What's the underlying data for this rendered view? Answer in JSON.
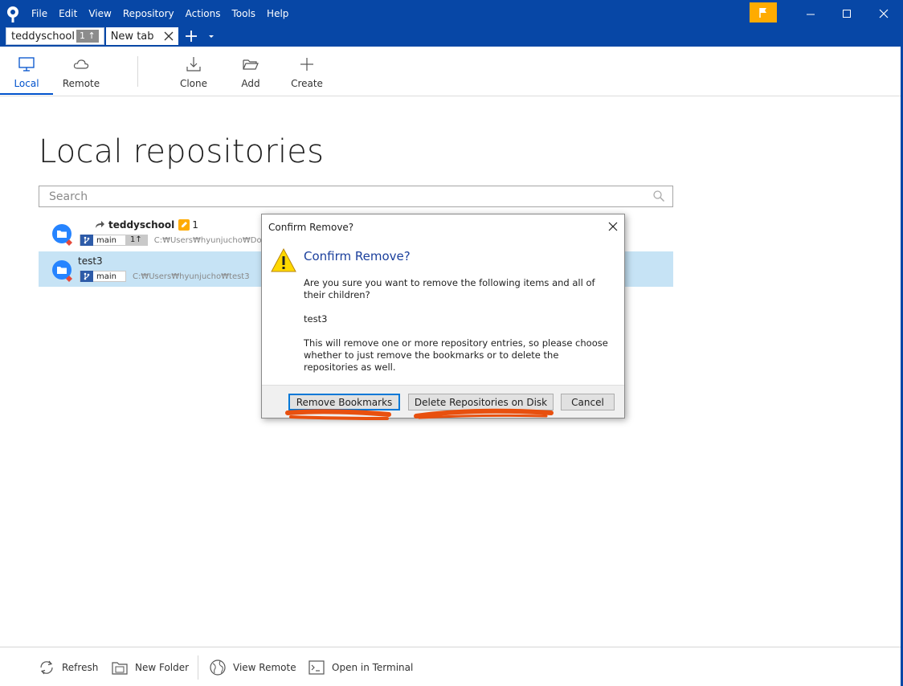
{
  "menu": [
    "File",
    "Edit",
    "View",
    "Repository",
    "Actions",
    "Tools",
    "Help"
  ],
  "tabs": {
    "active": {
      "label": "teddyschool",
      "badge": "1 ↑"
    },
    "new": {
      "label": "New tab"
    }
  },
  "toolbar": {
    "local": "Local",
    "remote": "Remote",
    "clone": "Clone",
    "add": "Add",
    "create": "Create"
  },
  "main": {
    "title": "Local repositories",
    "search_placeholder": "Search"
  },
  "repos": [
    {
      "name": "teddyschool",
      "changes": "1",
      "branch": "main",
      "ahead": "1↑",
      "path": "C:₩Users₩hyunjucho₩Docum"
    },
    {
      "name": "test3",
      "branch": "main",
      "path": "C:₩Users₩hyunjucho₩test3"
    }
  ],
  "dialog": {
    "window_title": "Confirm Remove?",
    "heading": "Confirm Remove?",
    "question": "Are you sure you want to remove the following items and all of their children?",
    "item": "test3",
    "explanation": "This will remove one or more repository entries, so please choose whether to just remove the bookmarks or to delete the repositories as well.",
    "buttons": {
      "remove_bookmarks": "Remove Bookmarks",
      "delete_on_disk": "Delete Repositories on Disk",
      "cancel": "Cancel"
    }
  },
  "bottom": {
    "refresh": "Refresh",
    "new_folder": "New Folder",
    "view_remote": "View Remote",
    "open_terminal": "Open in Terminal"
  },
  "colors": {
    "titlebar": "#0747a6",
    "accent": "#0052cc",
    "flag": "#ffab00",
    "selected_row": "#c6e3f5",
    "annotation": "#e8500f"
  }
}
